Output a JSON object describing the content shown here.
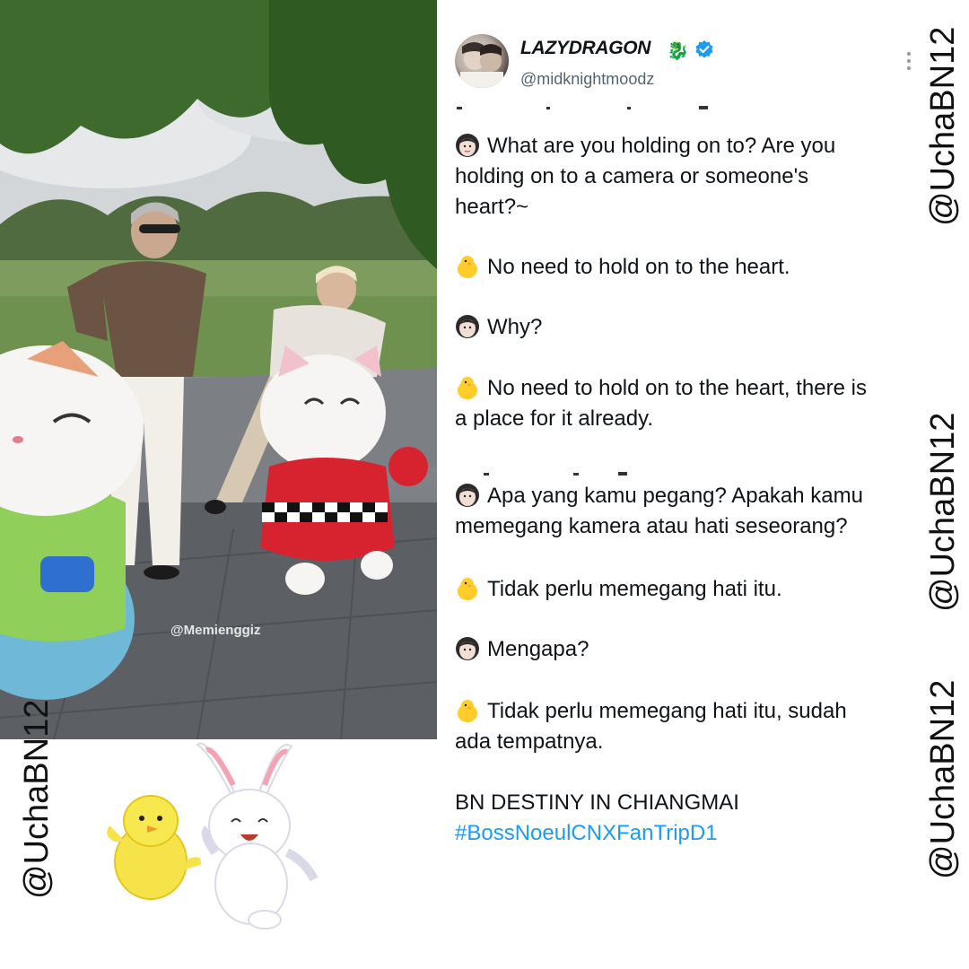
{
  "photo": {
    "credit": "@Memienggiz"
  },
  "tweet": {
    "display_name": "LAZYDRAGON",
    "name_emoji": "🐉",
    "handle": "@midknightmoodz",
    "lines": [
      "What are you holding on to? Are you",
      "holding on to a camera or someone's",
      "heart?~",
      "No need to hold on to the heart.",
      "Why?",
      "No need to hold on to the heart, there is",
      "a place for it already.",
      "Apa yang kamu pegang? Apakah kamu",
      "memegang kamera atau hati seseorang?",
      "Tidak perlu memegang hati itu.",
      "Mengapa?",
      "Tidak perlu memegang hati itu, sudah",
      "ada tempatnya.",
      "BN DESTINY IN CHIANGMAI"
    ],
    "hashtag": "#BossNoeulCNXFanTripD1"
  },
  "watermark": "@UchaBN12",
  "colors": {
    "hashtag": "#1d9bf0",
    "verified": "#1d9bf0",
    "text": "#0f1419",
    "muted": "#536471"
  },
  "icons": [
    "woman-emoji",
    "chick-emoji",
    "dragon-emoji",
    "verified-badge",
    "more-dots",
    "chick-sticker",
    "bunny-sticker"
  ]
}
